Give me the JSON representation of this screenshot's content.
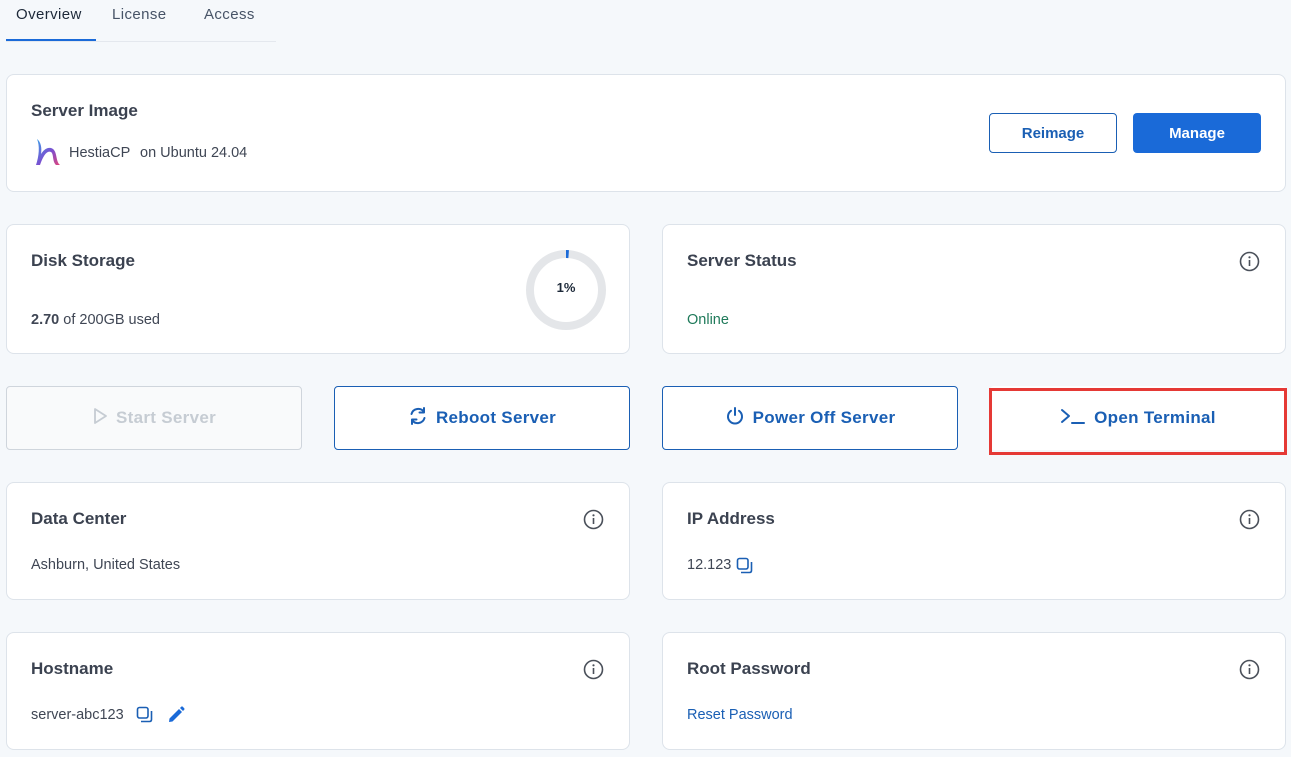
{
  "tabs": [
    {
      "label": "Overview",
      "active": true
    },
    {
      "label": "License",
      "active": false
    },
    {
      "label": "Access",
      "active": false
    }
  ],
  "server_image": {
    "title": "Server Image",
    "app_name": "HestiaCP",
    "os": "on Ubuntu 24.04",
    "reimage_label": "Reimage",
    "manage_label": "Manage"
  },
  "disk": {
    "title": "Disk Storage",
    "used": "2.70",
    "of_text": "of 200GB used",
    "percent_label": "1%",
    "percent_value": 1
  },
  "status": {
    "title": "Server Status",
    "value": "Online"
  },
  "actions": {
    "start": "Start Server",
    "reboot": "Reboot Server",
    "power_off": "Power Off Server",
    "terminal": "Open Terminal"
  },
  "datacenter": {
    "title": "Data Center",
    "value": "Ashburn, United States"
  },
  "ip": {
    "title": "IP Address",
    "value": "12.123"
  },
  "hostname": {
    "title": "Hostname",
    "value": "server-abc123"
  },
  "root_password": {
    "title": "Root Password",
    "reset_label": "Reset Password"
  },
  "colors": {
    "accent": "#1a6ad8",
    "online": "#1f7a5a",
    "highlight": "#e53935"
  },
  "icons": [
    "hestiacp-logo",
    "info-icon",
    "play-icon",
    "refresh-icon",
    "power-icon",
    "terminal-icon",
    "copy-icon",
    "pencil-icon"
  ]
}
